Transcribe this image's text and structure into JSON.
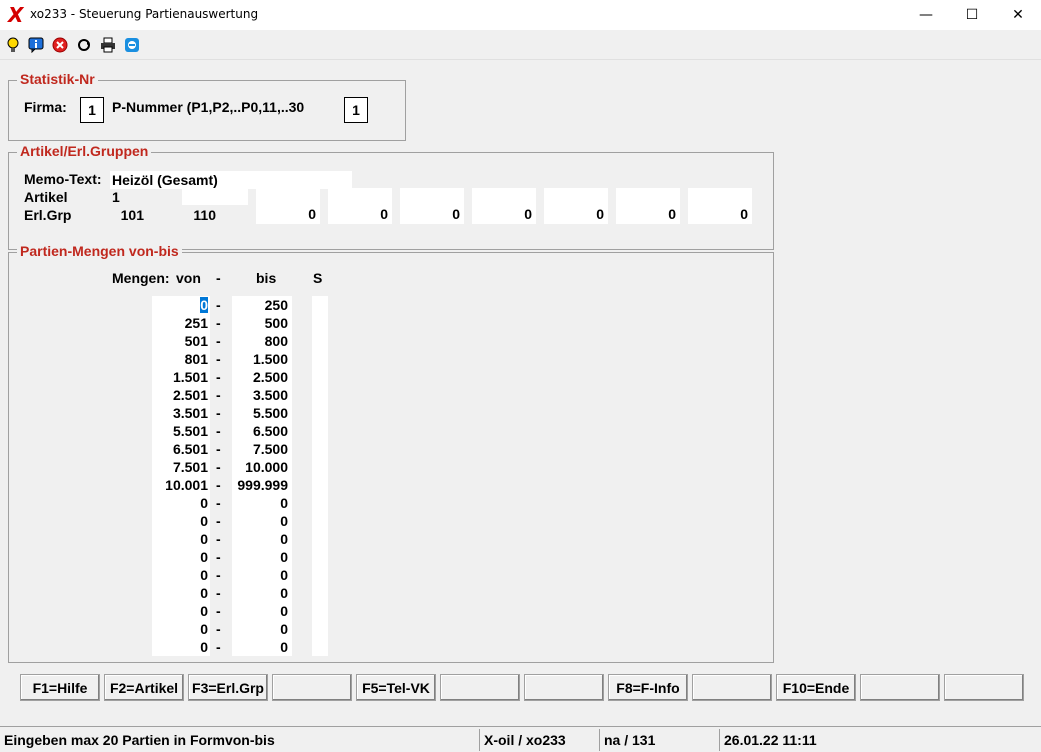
{
  "window": {
    "app_glyph": "X",
    "title": "xo233 - Steuerung Partienauswertung",
    "min": "—",
    "max": "☐",
    "close": "✕"
  },
  "toolbar": {
    "icons": [
      "lightbulb-icon",
      "info-icon",
      "cancel-icon",
      "refresh-icon",
      "printer-icon",
      "remote-icon"
    ]
  },
  "statistik": {
    "legend": "Statistik-Nr",
    "firma_label": "Firma:",
    "firma_value": "1",
    "pnummer_label": "P-Nummer (P1,P2,..P0,11,..30",
    "pnummer_value": "1"
  },
  "artikel": {
    "legend": "Artikel/Erl.Gruppen",
    "memo_label": "Memo-Text:",
    "memo_value": "Heizöl (Gesamt)",
    "artikel_label": "Artikel",
    "artikel_value": "1",
    "erlgrp_label": "Erl.Grp",
    "erlgrp_values": [
      "101",
      "110",
      "0",
      "0",
      "0",
      "0",
      "0",
      "0",
      "0"
    ]
  },
  "partien": {
    "legend": "Partien-Mengen von-bis",
    "mengen_label": "Mengen:",
    "von_label": "von",
    "dash": "-",
    "bis_label": "bis",
    "s_label": "S",
    "von": [
      "0",
      "251",
      "501",
      "801",
      "1.501",
      "2.501",
      "3.501",
      "5.501",
      "6.501",
      "7.501",
      "10.001",
      "0",
      "0",
      "0",
      "0",
      "0",
      "0",
      "0",
      "0",
      "0"
    ],
    "bis": [
      "250",
      "500",
      "800",
      "1.500",
      "2.500",
      "3.500",
      "5.500",
      "6.500",
      "7.500",
      "10.000",
      "999.999",
      "0",
      "0",
      "0",
      "0",
      "0",
      "0",
      "0",
      "0",
      "0"
    ]
  },
  "fkeys": [
    "F1=Hilfe",
    "F2=Artikel",
    "F3=Erl.Grp",
    "",
    "F5=Tel-VK",
    "",
    "",
    "F8=F-Info",
    "",
    "F10=Ende",
    "",
    ""
  ],
  "status": {
    "message": "Eingeben max 20 Partien in Formvon-bis",
    "app": "X-oil / xo233",
    "user": "na / 131",
    "datetime": "26.01.22 11:11"
  }
}
